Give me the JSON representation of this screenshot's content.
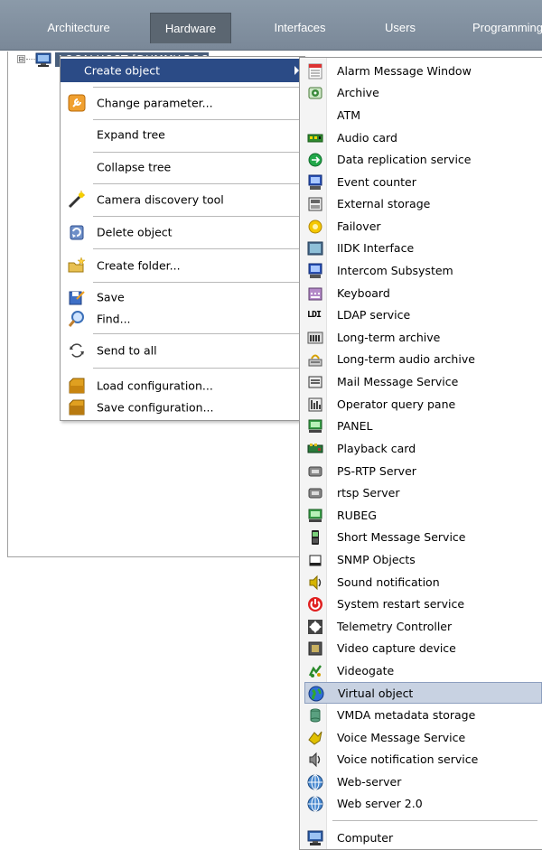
{
  "tabs": [
    {
      "label": "Architecture",
      "active": false
    },
    {
      "label": "Hardware",
      "active": true
    },
    {
      "label": "Interfaces",
      "active": false
    },
    {
      "label": "Users",
      "active": false
    },
    {
      "label": "Programming",
      "active": false
    }
  ],
  "tree": {
    "root_label": "LOCALHOST [DUMMY-ROOT]"
  },
  "context_menu": {
    "items": [
      {
        "label": "Create object",
        "icon": "none",
        "has_submenu": true,
        "highlighted": true
      },
      {
        "label": "Change parameter...",
        "icon": "wrench-icon"
      },
      {
        "label": "Expand tree",
        "icon": "none"
      },
      {
        "label": "Collapse tree",
        "icon": "none"
      },
      {
        "label": "Camera discovery tool",
        "icon": "magic-wand-icon"
      },
      {
        "label": "Delete object",
        "icon": "delete-icon"
      },
      {
        "label": "Create folder...",
        "icon": "new-folder-icon"
      },
      {
        "label": "Save",
        "icon": "save-icon"
      },
      {
        "label": "Find...",
        "icon": "magnifier-icon"
      },
      {
        "label": "Send to all",
        "icon": "refresh-icon"
      },
      {
        "label": "Load configuration...",
        "icon": "load-config-icon"
      },
      {
        "label": "Save configuration...",
        "icon": "save-config-icon"
      }
    ]
  },
  "submenu": {
    "items": [
      {
        "label": "Alarm Message Window",
        "icon": "alarm-window-icon"
      },
      {
        "label": "Archive",
        "icon": "archive-icon"
      },
      {
        "label": "ATM",
        "icon": "none"
      },
      {
        "label": "Audio card",
        "icon": "audio-card-icon"
      },
      {
        "label": "Data replication service",
        "icon": "data-replication-icon"
      },
      {
        "label": "Event counter",
        "icon": "event-counter-icon"
      },
      {
        "label": "External storage",
        "icon": "external-storage-icon"
      },
      {
        "label": "Failover",
        "icon": "failover-icon"
      },
      {
        "label": "IIDK Interface",
        "icon": "iidk-icon"
      },
      {
        "label": "Intercom Subsystem",
        "icon": "intercom-icon"
      },
      {
        "label": "Keyboard",
        "icon": "keyboard-icon"
      },
      {
        "label": "LDAP service",
        "icon": "ldap-icon",
        "icon_text": "LDI"
      },
      {
        "label": "Long-term archive",
        "icon": "long-term-archive-icon"
      },
      {
        "label": "Long-term audio archive",
        "icon": "audio-archive-icon"
      },
      {
        "label": "Mail Message Service",
        "icon": "mail-icon"
      },
      {
        "label": "Operator query pane",
        "icon": "query-pane-icon"
      },
      {
        "label": "PANEL",
        "icon": "panel-icon"
      },
      {
        "label": "Playback card",
        "icon": "playback-card-icon"
      },
      {
        "label": "PS-RTP Server",
        "icon": "server-icon"
      },
      {
        "label": "rtsp Server",
        "icon": "server-icon"
      },
      {
        "label": "RUBEG",
        "icon": "rubeg-icon"
      },
      {
        "label": "Short Message Service",
        "icon": "phone-icon"
      },
      {
        "label": "SNMP Objects",
        "icon": "snmp-icon"
      },
      {
        "label": "Sound notification",
        "icon": "sound-icon"
      },
      {
        "label": "System restart service",
        "icon": "power-icon"
      },
      {
        "label": "Telemetry Controller",
        "icon": "telemetry-icon"
      },
      {
        "label": "Video capture device",
        "icon": "video-capture-icon"
      },
      {
        "label": "Videogate",
        "icon": "videogate-icon"
      },
      {
        "label": "Virtual object",
        "icon": "globe-icon",
        "selected": true
      },
      {
        "label": "VMDA metadata storage",
        "icon": "database-icon"
      },
      {
        "label": "Voice Message Service",
        "icon": "voice-message-icon"
      },
      {
        "label": "Voice notification service",
        "icon": "speaker-icon"
      },
      {
        "label": "Web-server",
        "icon": "web-server-icon"
      },
      {
        "label": "Web server 2.0",
        "icon": "web-server-icon"
      },
      {
        "label": "Computer",
        "icon": "computer-icon"
      }
    ]
  },
  "colors": {
    "tabbar": "#8b9aa9",
    "active_tab": "#5b6671",
    "menu_highlight": "#2b4b86",
    "submenu_selected": "#c8d2e2"
  }
}
